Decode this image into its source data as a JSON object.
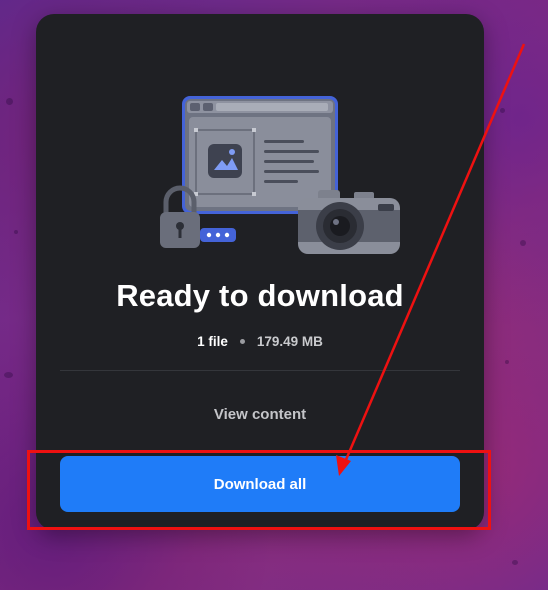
{
  "card": {
    "title": "Ready to download",
    "file_count": "1 file",
    "file_size": "179.49 MB",
    "view_content_label": "View content",
    "download_all_label": "Download all"
  },
  "colors": {
    "card_background": "#1f2024",
    "button_primary": "#1f7cf8",
    "annotation_red": "#ee1111"
  },
  "icons": {
    "hero": "file-transfer-illustration",
    "lock": "padlock-icon",
    "camera": "camera-icon",
    "image": "image-icon"
  }
}
